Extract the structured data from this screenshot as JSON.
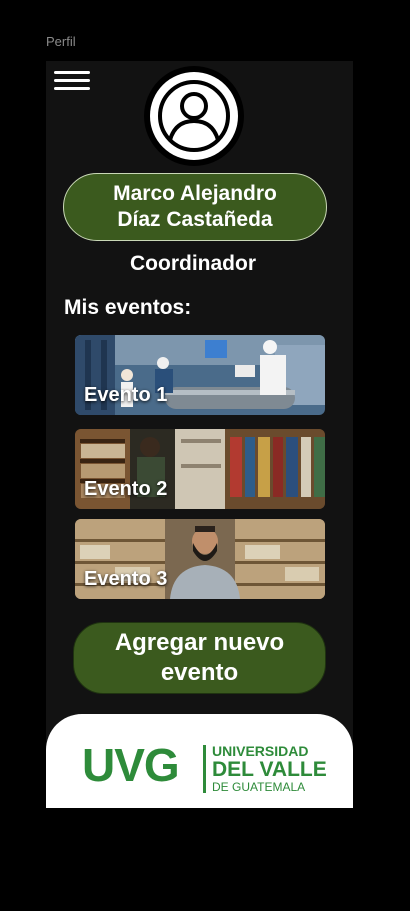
{
  "frame_label": "Perfil",
  "user": {
    "name_line1": "Marco Alejandro",
    "name_line2": "Díaz Castañeda",
    "role": "Coordinador"
  },
  "section_title": "Mis eventos:",
  "events": [
    {
      "label": "Evento 1"
    },
    {
      "label": "Evento 2"
    },
    {
      "label": "Evento 3"
    }
  ],
  "add_button": {
    "line1": "Agregar nuevo",
    "line2": "evento"
  },
  "footer": {
    "logo_short": "UVG",
    "logo_line1": "UNIVERSIDAD",
    "logo_line2": "DEL VALLE",
    "logo_line3": "DE GUATEMALA"
  },
  "colors": {
    "accent_green": "#3b5a1e",
    "brand_green": "#2e8b3a",
    "background": "#121212"
  }
}
